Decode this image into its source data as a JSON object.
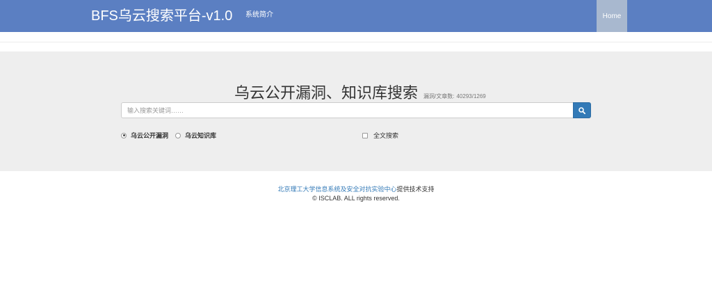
{
  "navbar": {
    "brand": "BFS乌云搜索平台-v1.0",
    "about_link": "系统简介",
    "home_link": "Home"
  },
  "search": {
    "heading": "乌云公开漏洞、知识库搜索",
    "count_label": "漏洞/文章数:",
    "count_value": "40293/1269",
    "placeholder": "输入搜索关键词……",
    "value": ""
  },
  "options": {
    "radio_vulns": {
      "label": "乌云公开漏洞",
      "checked": true
    },
    "radio_kb": {
      "label": "乌云知识库",
      "checked": false
    },
    "fulltext": {
      "label": "全文搜索",
      "checked": false
    }
  },
  "footer": {
    "support_link": "北京理工大学信息系统及安全对抗实验中心",
    "support_suffix": "提供技术支持",
    "copyright": "© ISCLAB. ALL rights reserved."
  },
  "colors": {
    "navbar": "#5b7fc2",
    "home_active": "#a8b8cf",
    "jumbotron": "#eeeeee",
    "primary_button": "#337ab7",
    "link": "#337ab7"
  },
  "icons": {
    "search_button": "search-icon"
  }
}
